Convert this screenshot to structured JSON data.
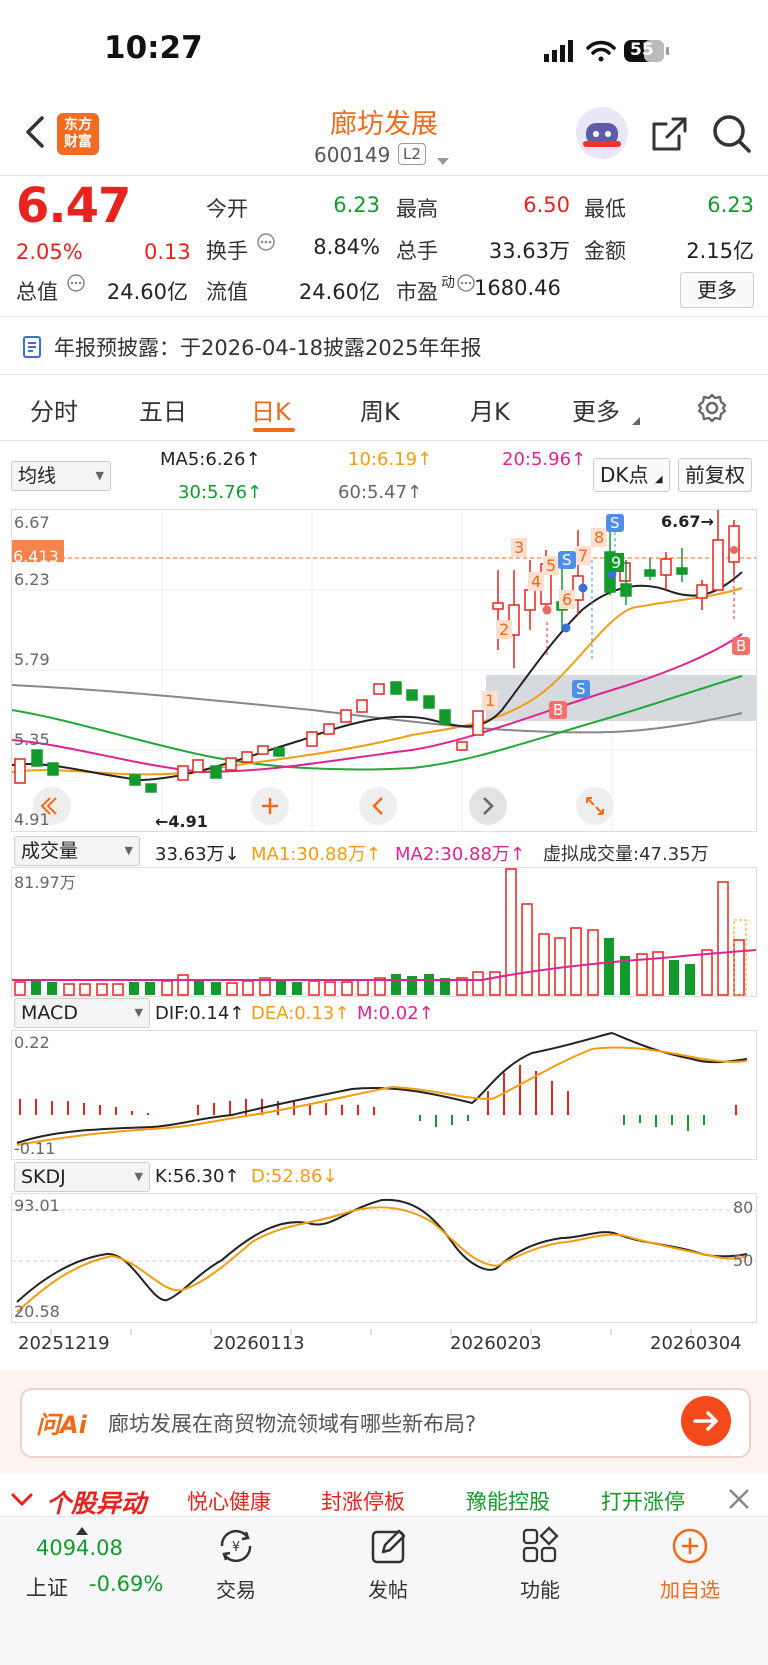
{
  "status": {
    "time": "10:27",
    "battery": "55"
  },
  "header": {
    "title": "廊坊发展",
    "code": "600149",
    "level": "L2",
    "logo_line1": "东方",
    "logo_line2": "财富"
  },
  "quote": {
    "price": "6.47",
    "pct": "2.05%",
    "change": "0.13",
    "open_label": "今开",
    "open": "6.23",
    "high_label": "最高",
    "high": "6.50",
    "low_label": "最低",
    "low": "6.23",
    "turnover_label": "换手",
    "turnover": "8.84%",
    "volume_label": "总手",
    "volume": "33.63万",
    "amount_label": "金额",
    "amount": "2.15亿",
    "mktcap_label": "总值",
    "mktcap": "24.60亿",
    "float_label": "流值",
    "float": "24.60亿",
    "pe_label": "市盈",
    "pe_sup": "动",
    "pe": "1680.46",
    "more": "更多"
  },
  "notice": "年报预披露：于2026-04-18披露2025年年报",
  "tabs": [
    "分时",
    "五日",
    "日K",
    "周K",
    "月K",
    "更多"
  ],
  "ma_bar": {
    "selector": "均线",
    "ma5": "MA5:6.26↑",
    "ma10": "10:6.19↑",
    "ma20": "20:5.96↑",
    "ma30": "30:5.76↑",
    "ma60": "60:5.47↑",
    "dk": "DK点",
    "adjust": "前复权"
  },
  "kline": {
    "y_top": "6.67",
    "y_2": "6.23",
    "y_3": "5.79",
    "y_4": "5.35",
    "y_bottom": "4.91",
    "current_tag": "6.413",
    "high_marker": "6.67→",
    "low_marker": "←4.91",
    "signal_numbers": [
      "1",
      "2",
      "3",
      "4",
      "5",
      "6",
      "7",
      "8",
      "9",
      "9"
    ],
    "signal_b": "B",
    "signal_s": "S"
  },
  "volume_bar": {
    "selector": "成交量",
    "vol": "33.63万↓",
    "ma1": "MA1:30.88万↑",
    "ma2": "MA2:30.88万↑",
    "virtual": "虚拟成交量:47.35万",
    "y_top": "81.97万"
  },
  "macd_bar": {
    "selector": "MACD",
    "dif": "DIF:0.14↑",
    "dea": "DEA:0.13↑",
    "m": "M:0.02↑",
    "y_top": "0.22",
    "y_bottom": "-0.11"
  },
  "skdj_bar": {
    "selector": "SKDJ",
    "k": "K:56.30↑",
    "d": "D:52.86↓",
    "y_top": "93.01",
    "y_bottom": "20.58",
    "r80": "80",
    "r50": "50"
  },
  "dates": [
    "20251219",
    "20260113",
    "20260203",
    "20260304"
  ],
  "ai": {
    "logo": "问Ai",
    "question": "廊坊发展在商贸物流领域有哪些新布局?"
  },
  "ticker": {
    "title": "个股异动",
    "items": [
      "悦心健康",
      "封涨停板",
      "豫能控股",
      "打开涨停"
    ]
  },
  "bottom_nav": {
    "index_value": "4094.08",
    "index_name": "上证",
    "index_pct": "-0.69%",
    "trade": "交易",
    "post": "发帖",
    "func": "功能",
    "watch": "加自选"
  },
  "colors": {
    "up": "#e8231e",
    "down": "#139a2c",
    "accent": "#f06a1a",
    "ma10": "#f39c12",
    "ma20": "#e0248f"
  }
}
